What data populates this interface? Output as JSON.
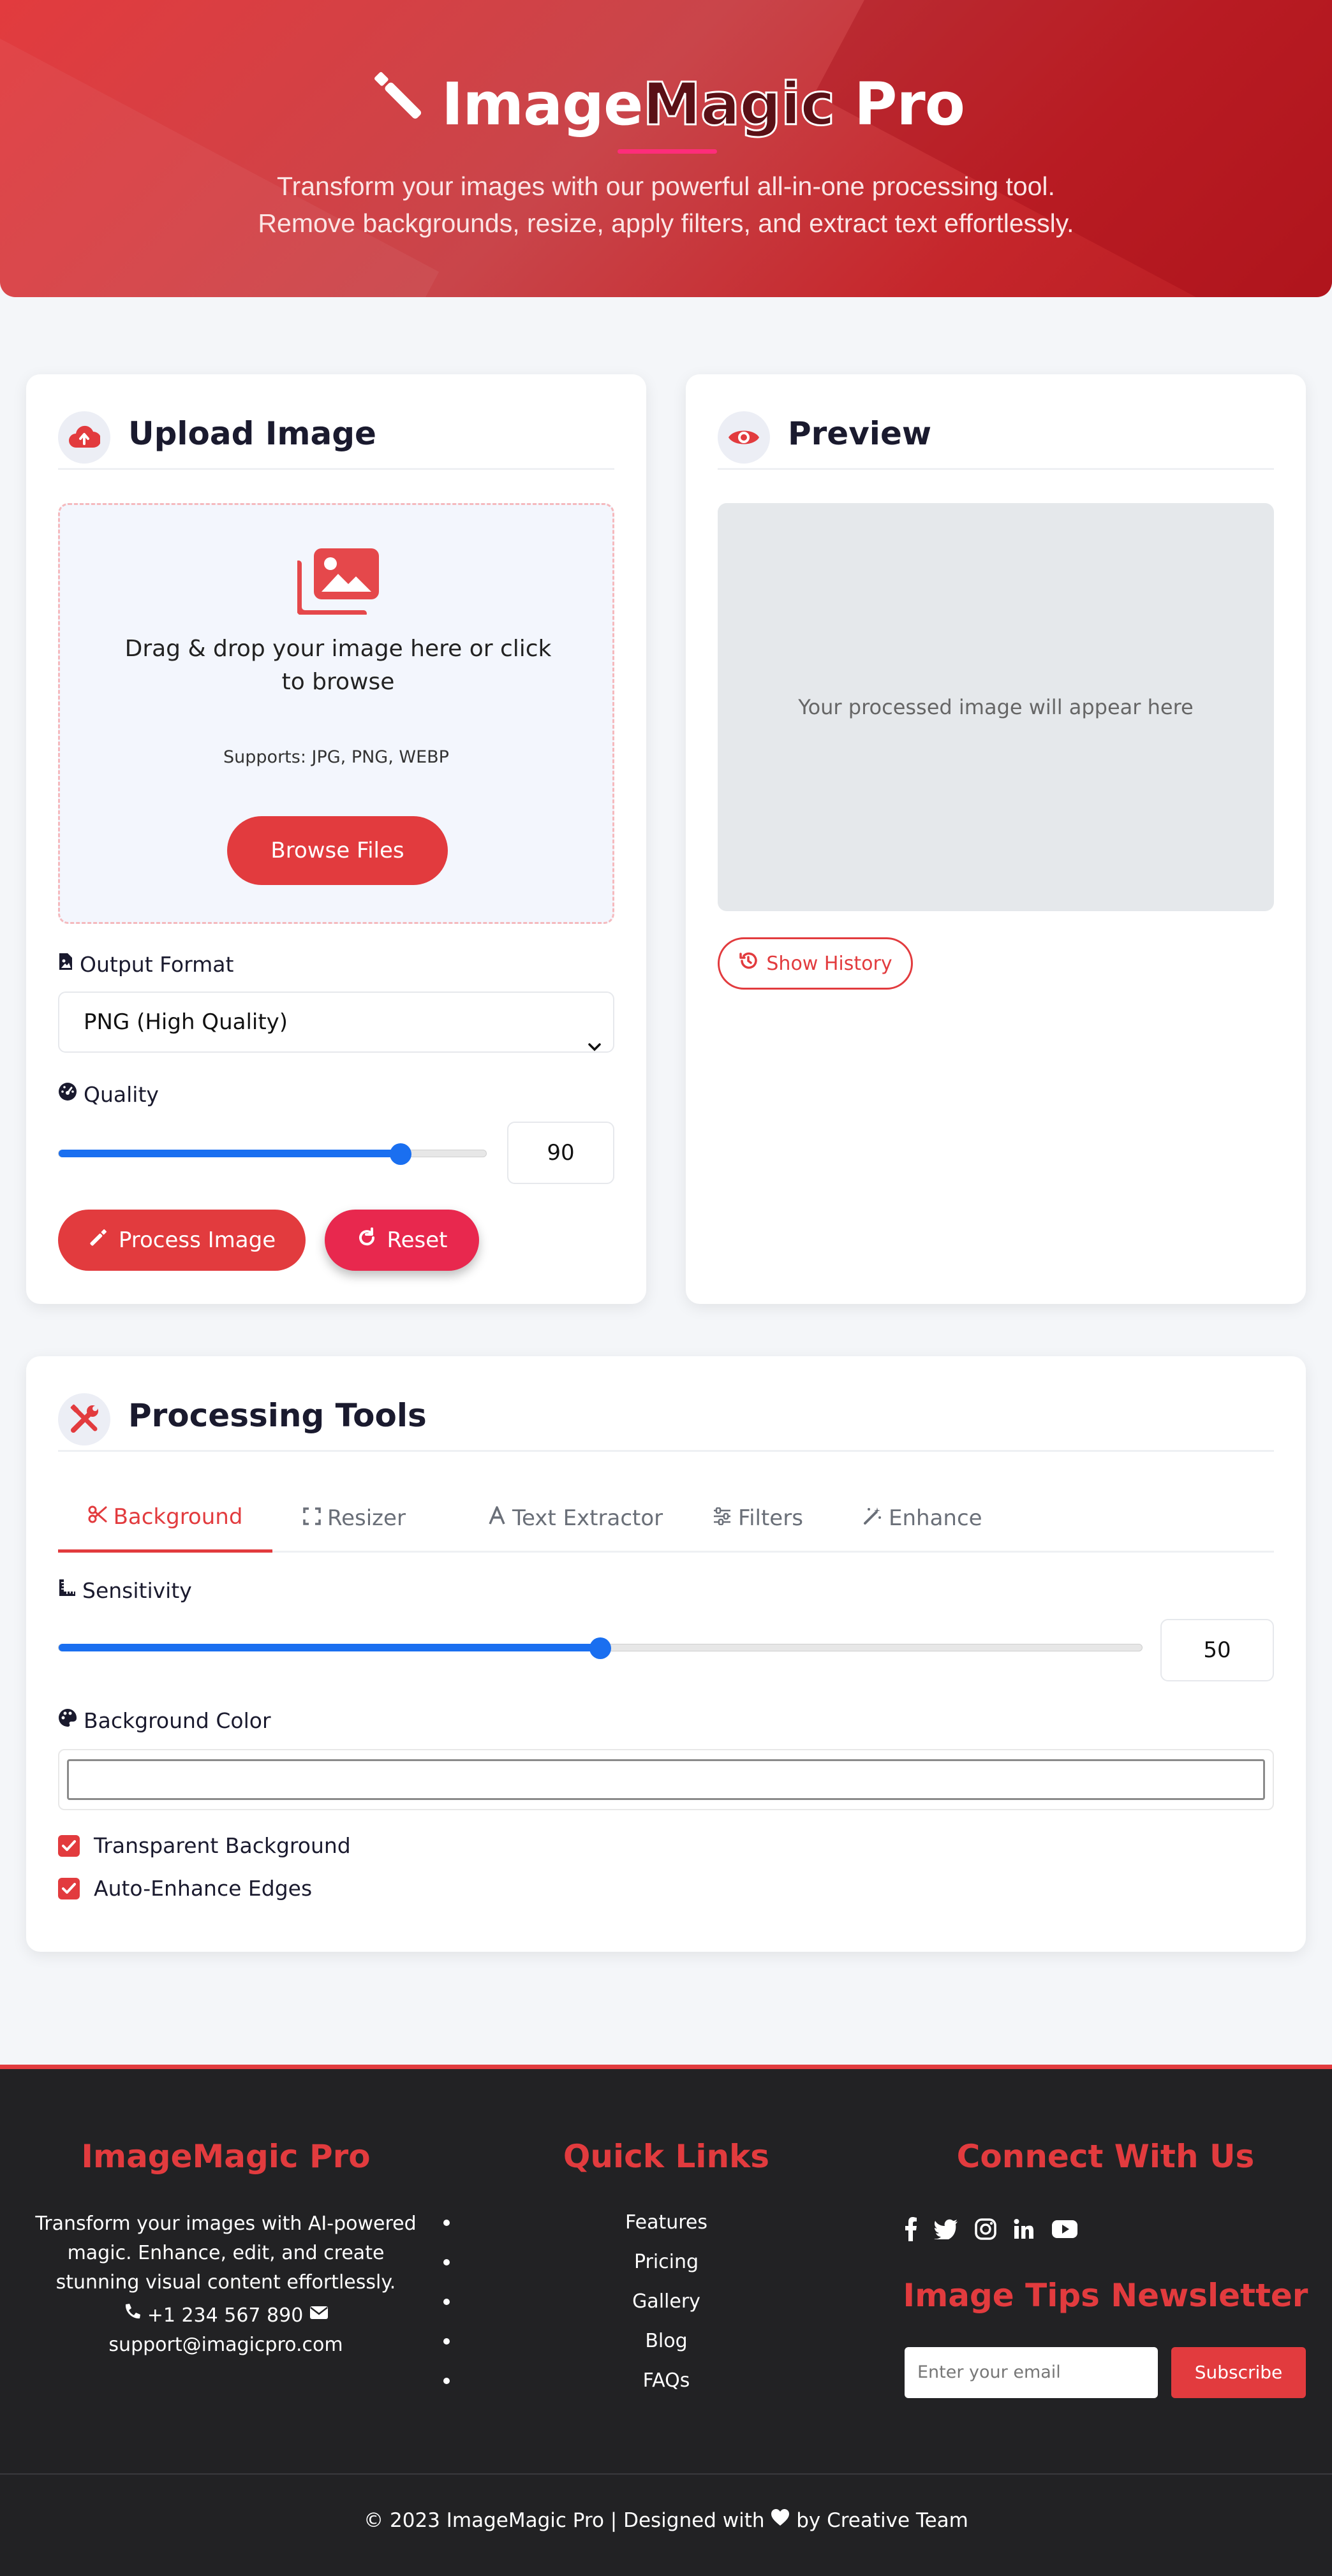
{
  "header": {
    "brand_part1": "Image",
    "brand_part2": "Magic",
    "brand_part3": " Pro",
    "subtitle_line1": "Transform your images with our powerful all-in-one processing tool.",
    "subtitle_line2": "Remove backgrounds, resize, apply filters, and extract text effortlessly."
  },
  "upload": {
    "title": "Upload Image",
    "drop_text": "Drag & drop your image here or click to browse",
    "supports": "Supports: JPG, PNG, WEBP",
    "browse_label": "Browse Files",
    "output_format_label": "Output Format",
    "output_format_value": "PNG (High Quality)",
    "quality_label": "Quality",
    "quality_value": "90",
    "quality_fraction": 0.9,
    "process_label": "Process Image",
    "reset_label": "Reset"
  },
  "preview": {
    "title": "Preview",
    "placeholder": "Your processed image will appear here",
    "history_label": "Show History"
  },
  "tools": {
    "title": "Processing Tools",
    "tabs": [
      {
        "label": "Background",
        "icon": "scissors-icon",
        "active": true
      },
      {
        "label": "Resizer",
        "icon": "expand-icon",
        "active": false
      },
      {
        "label": "Text Extractor",
        "icon": "font-icon",
        "active": false
      },
      {
        "label": "Filters",
        "icon": "sliders-icon",
        "active": false
      },
      {
        "label": "Enhance",
        "icon": "magic-wand-icon",
        "active": false
      }
    ],
    "sensitivity_label": "Sensitivity",
    "sensitivity_value": "50",
    "sensitivity_fraction": 0.5,
    "bg_color_label": "Background Color",
    "checkbox_transparent": "Transparent Background",
    "checkbox_edges": "Auto-Enhance Edges"
  },
  "footer": {
    "about_title": "ImageMagic Pro",
    "about_text": "Transform your images with AI-powered magic. Enhance, edit, and create stunning visual content effortlessly.",
    "phone": "+1 234 567 890",
    "email": "support@imagicpro.com",
    "links_title": "Quick Links",
    "links": [
      "Features",
      "Pricing",
      "Gallery",
      "Blog",
      "FAQs"
    ],
    "connect_title": "Connect With Us",
    "newsletter_title": "Image Tips Newsletter",
    "email_placeholder": "Enter your email",
    "subscribe_label": "Subscribe",
    "copyright_pre": "© 2023 ImageMagic Pro | Designed with",
    "copyright_post": "by Creative Team"
  },
  "colors": {
    "accent": "#e23b3e",
    "slider": "#1a6ff0",
    "footer_bg": "#222224"
  }
}
